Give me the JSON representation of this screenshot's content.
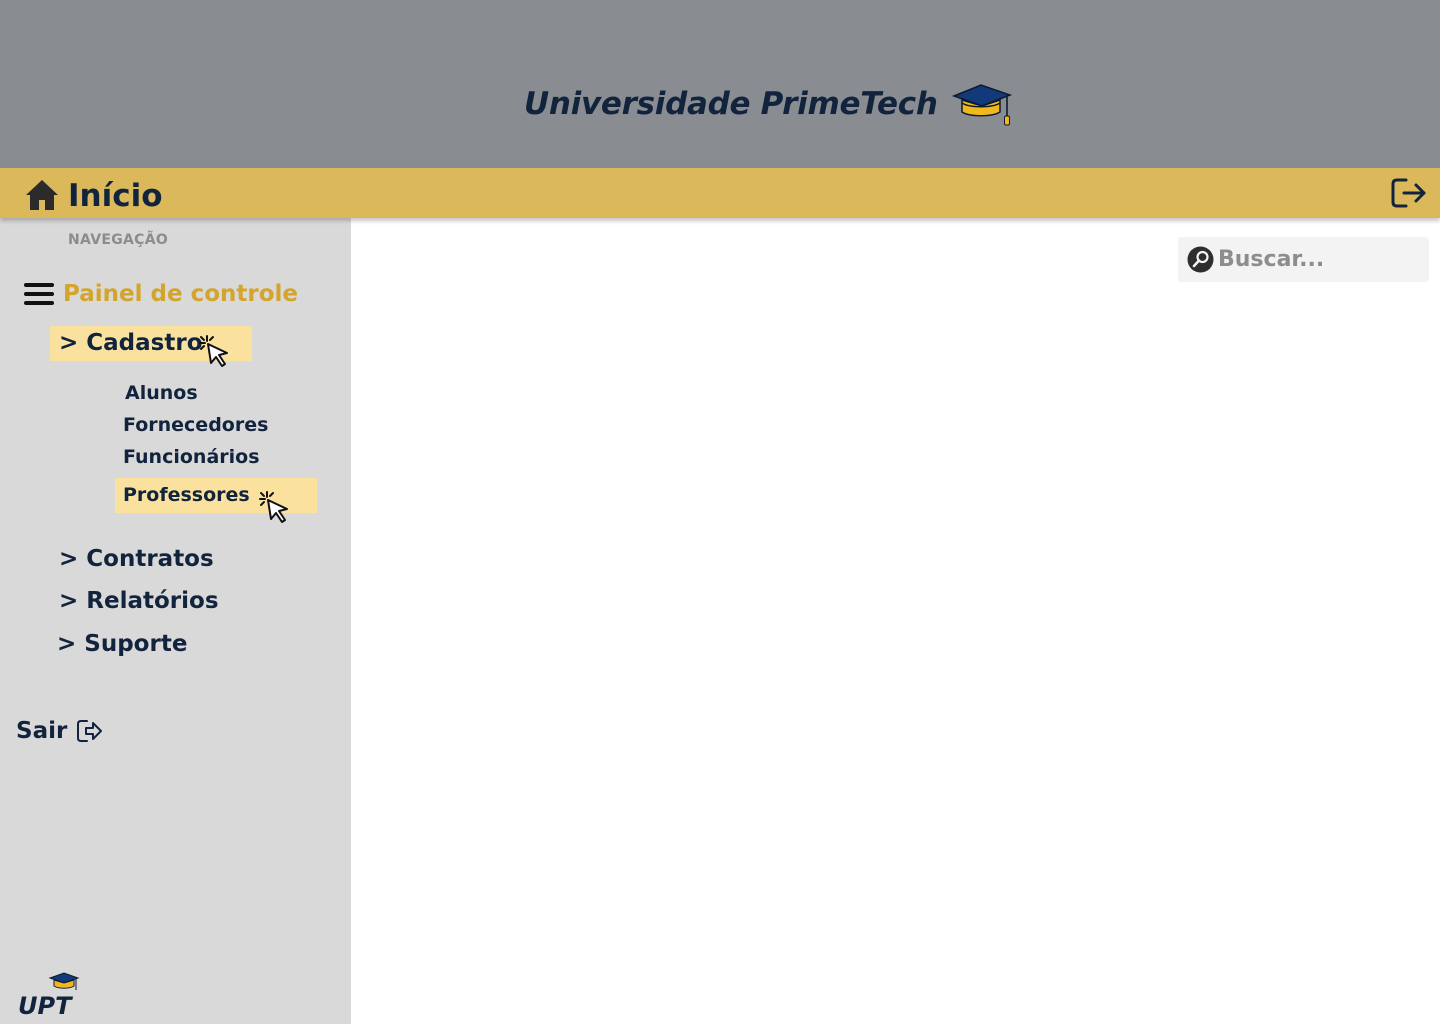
{
  "header": {
    "brand_title": "Universidade PrimeTech",
    "brand_icon": "graduation-cap-icon",
    "background": "#898d91"
  },
  "homebar": {
    "title": "Início",
    "home_icon": "home-icon",
    "logout_icon": "logout-icon",
    "background": "#dbb95a"
  },
  "sidebar": {
    "heading": "NAVEGAÇÃO",
    "panel_title": "Painel de controle",
    "menu_icon": "hamburger-menu-icon",
    "cadastro": {
      "label": "> Cadastro",
      "items": [
        {
          "label": "Alunos"
        },
        {
          "label": "Fornecedores"
        },
        {
          "label": "Funcionários"
        },
        {
          "label": "Professores"
        }
      ]
    },
    "sections": [
      {
        "label": "> Contratos"
      },
      {
        "label": "> Relatórios"
      },
      {
        "label": "> Suporte"
      }
    ],
    "exit_label": "Sair",
    "logo_text": "UPT",
    "highlight_color": "#fae29e",
    "accent_color": "#d4a42b",
    "background": "#d9d9d9"
  },
  "search": {
    "placeholder": "Buscar...",
    "value": ""
  },
  "colors": {
    "navy": "#12243d",
    "gold": "#f1b81c"
  }
}
